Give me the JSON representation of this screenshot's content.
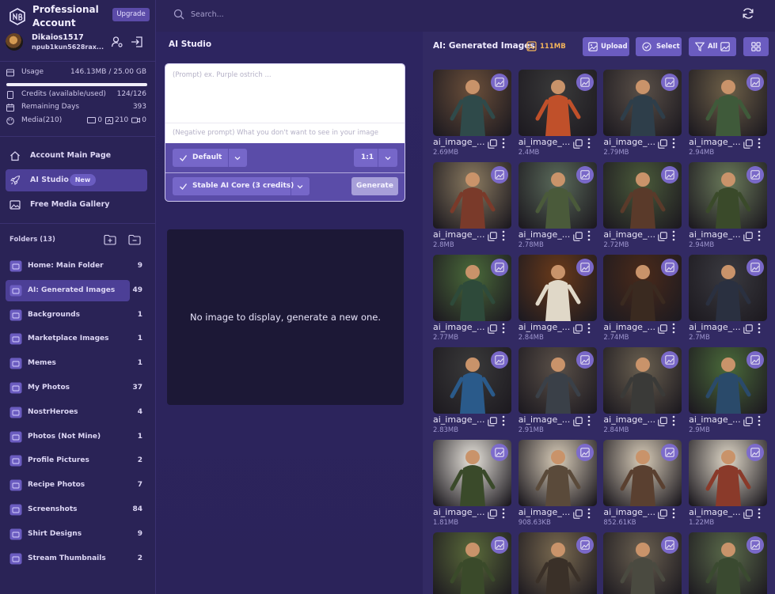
{
  "brand": {
    "title": "Professional Account",
    "upgrade_label": "Upgrade"
  },
  "user": {
    "name": "Dikaios1517",
    "npub": "npub1kun5628rax..."
  },
  "stats": {
    "usage_label": "Usage",
    "usage_value": "146.13MB / 25.00 GB",
    "usage_fraction": 0.0058,
    "credits_label": "Credits (available/used)",
    "credits_value": "124/126",
    "days_label": "Remaining Days",
    "days_value": "393",
    "media_label": "Media(210)",
    "media_images": "0",
    "media_gifs": "210",
    "media_videos": "0"
  },
  "nav": [
    {
      "label": "Account Main Page",
      "icon": "house-icon"
    },
    {
      "label": "AI Studio",
      "icon": "rocket-icon",
      "badge": "New"
    },
    {
      "label": "Free Media Gallery",
      "icon": "gallery-icon"
    }
  ],
  "folders_header": "Folders (13)",
  "folders": [
    {
      "label": "Home: Main Folder",
      "count": "9"
    },
    {
      "label": "AI: Generated Images",
      "count": "49"
    },
    {
      "label": "Backgrounds",
      "count": "1"
    },
    {
      "label": "Marketplace Images",
      "count": "1"
    },
    {
      "label": "Memes",
      "count": "1"
    },
    {
      "label": "My Photos",
      "count": "37"
    },
    {
      "label": "NostrHeroes",
      "count": "4"
    },
    {
      "label": "Photos (Not Mine)",
      "count": "1"
    },
    {
      "label": "Profile Pictures",
      "count": "2"
    },
    {
      "label": "Recipe Photos",
      "count": "7"
    },
    {
      "label": "Screenshots",
      "count": "84"
    },
    {
      "label": "Shirt Designs",
      "count": "9"
    },
    {
      "label": "Stream Thumbnails",
      "count": "2"
    }
  ],
  "search": {
    "placeholder": "Search..."
  },
  "studio": {
    "title": "AI Studio",
    "prompt_placeholder": "(Prompt) ex. Purple ostrich ...",
    "negative_placeholder": "(Negative prompt) What you don't want to see in your image",
    "style_label": "Default",
    "ratio_label": "1:1",
    "model_label": "Stable AI Core (3 credits)",
    "generate_label": "Generate",
    "empty_message": "No image to display, generate a new one."
  },
  "gallery": {
    "title": "AI: Generated Images",
    "size": "111MB",
    "upload_label": "Upload",
    "select_label": "Select",
    "filter_label": "All",
    "items": [
      {
        "name": "ai_image_...",
        "size": "2.69MB",
        "bg": "#6b4f3a",
        "fg": "#2f4a4a"
      },
      {
        "name": "ai_image_...",
        "size": "2.4MB",
        "bg": "#3a3a3a",
        "fg": "#c0502a"
      },
      {
        "name": "ai_image_...",
        "size": "2.79MB",
        "bg": "#5a5048",
        "fg": "#2e3e4a"
      },
      {
        "name": "ai_image_...",
        "size": "2.94MB",
        "bg": "#6e6048",
        "fg": "#3f5a3a"
      },
      {
        "name": "ai_image_...",
        "size": "2.8MB",
        "bg": "#8a7a60",
        "fg": "#7a3a2a"
      },
      {
        "name": "ai_image_...",
        "size": "2.78MB",
        "bg": "#5a6a5a",
        "fg": "#4a5a3a"
      },
      {
        "name": "ai_image_...",
        "size": "2.72MB",
        "bg": "#4a5a3a",
        "fg": "#5a3a2a"
      },
      {
        "name": "ai_image_...",
        "size": "2.94MB",
        "bg": "#6a7a5a",
        "fg": "#3a4a2a"
      },
      {
        "name": "ai_image_...",
        "size": "2.77MB",
        "bg": "#4a6a3a",
        "fg": "#2e4a3a"
      },
      {
        "name": "ai_image_...",
        "size": "2.84MB",
        "bg": "#6a3a1a",
        "fg": "#e0d8c8"
      },
      {
        "name": "ai_image_...",
        "size": "2.74MB",
        "bg": "#4a2a1a",
        "fg": "#3a2a20"
      },
      {
        "name": "ai_image_...",
        "size": "2.7MB",
        "bg": "#3a3a40",
        "fg": "#2a3040"
      },
      {
        "name": "ai_image_...",
        "size": "2.83MB",
        "bg": "#3a3a3a",
        "fg": "#2a5a8a"
      },
      {
        "name": "ai_image_...",
        "size": "2.91MB",
        "bg": "#5a5048",
        "fg": "#3a4048"
      },
      {
        "name": "ai_image_...",
        "size": "2.84MB",
        "bg": "#6a6050",
        "fg": "#3a3a38"
      },
      {
        "name": "ai_image_...",
        "size": "2.9MB",
        "bg": "#4a6a3a",
        "fg": "#2a4a6a"
      },
      {
        "name": "ai_image_...",
        "size": "1.81MB",
        "bg": "#e8e4dc",
        "fg": "#3a4a2a"
      },
      {
        "name": "ai_image_...",
        "size": "908.63KB",
        "bg": "#d8ccb8",
        "fg": "#5a4a3a"
      },
      {
        "name": "ai_image_...",
        "size": "852.61KB",
        "bg": "#d8ccb8",
        "fg": "#5a4030"
      },
      {
        "name": "ai_image_...",
        "size": "1.22MB",
        "bg": "#e0d8c8",
        "fg": "#8a3a2a"
      },
      {
        "name": "",
        "size": "",
        "bg": "#5a6a3a",
        "fg": "#3a4a2a"
      },
      {
        "name": "",
        "size": "",
        "bg": "#7a6a50",
        "fg": "#3a3028"
      },
      {
        "name": "",
        "size": "",
        "bg": "#6a6050",
        "fg": "#4a4a40"
      },
      {
        "name": "",
        "size": "",
        "bg": "#5a6a4a",
        "fg": "#3a4a30"
      }
    ]
  }
}
